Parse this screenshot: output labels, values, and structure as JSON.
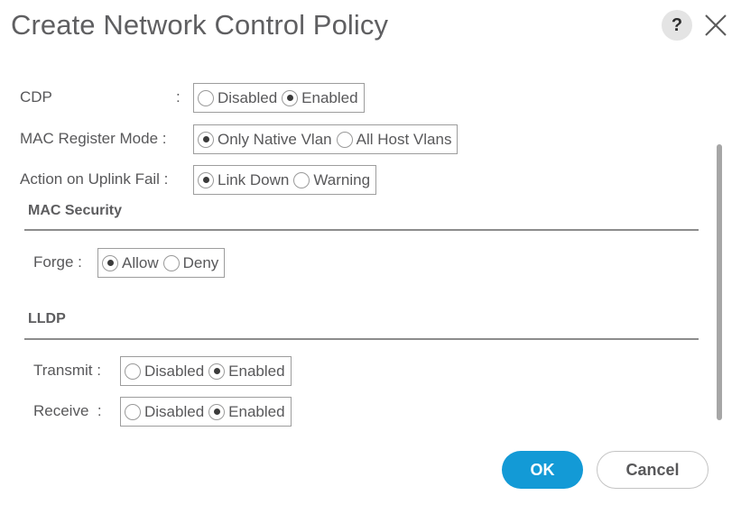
{
  "dialog": {
    "title": "Create Network Control Policy",
    "help_label": "?",
    "help_icon": "question-mark-icon",
    "close_icon": "close-x-icon"
  },
  "fields": {
    "cdp": {
      "label": "CDP",
      "colon": ":",
      "options": [
        {
          "label": "Disabled",
          "checked": false
        },
        {
          "label": "Enabled",
          "checked": true
        }
      ]
    },
    "mac_register_mode": {
      "label": "MAC Register Mode :",
      "options": [
        {
          "label": "Only Native Vlan",
          "checked": true
        },
        {
          "label": "All Host Vlans",
          "checked": false
        }
      ]
    },
    "action_on_uplink_fail": {
      "label": "Action on Uplink Fail :",
      "options": [
        {
          "label": "Link Down",
          "checked": true
        },
        {
          "label": "Warning",
          "checked": false
        }
      ]
    }
  },
  "mac_security": {
    "title": "MAC Security",
    "forge": {
      "label": "Forge :",
      "options": [
        {
          "label": "Allow",
          "checked": true
        },
        {
          "label": "Deny",
          "checked": false
        }
      ]
    }
  },
  "lldp": {
    "title": "LLDP",
    "transmit": {
      "label": "Transmit :",
      "options": [
        {
          "label": "Disabled",
          "checked": false
        },
        {
          "label": "Enabled",
          "checked": true
        }
      ]
    },
    "receive": {
      "label": "Receive  :",
      "options": [
        {
          "label": "Disabled",
          "checked": false
        },
        {
          "label": "Enabled",
          "checked": true
        }
      ]
    }
  },
  "footer": {
    "ok_label": "OK",
    "cancel_label": "Cancel"
  },
  "colors": {
    "primary": "#139ad6",
    "text": "#58585a"
  }
}
